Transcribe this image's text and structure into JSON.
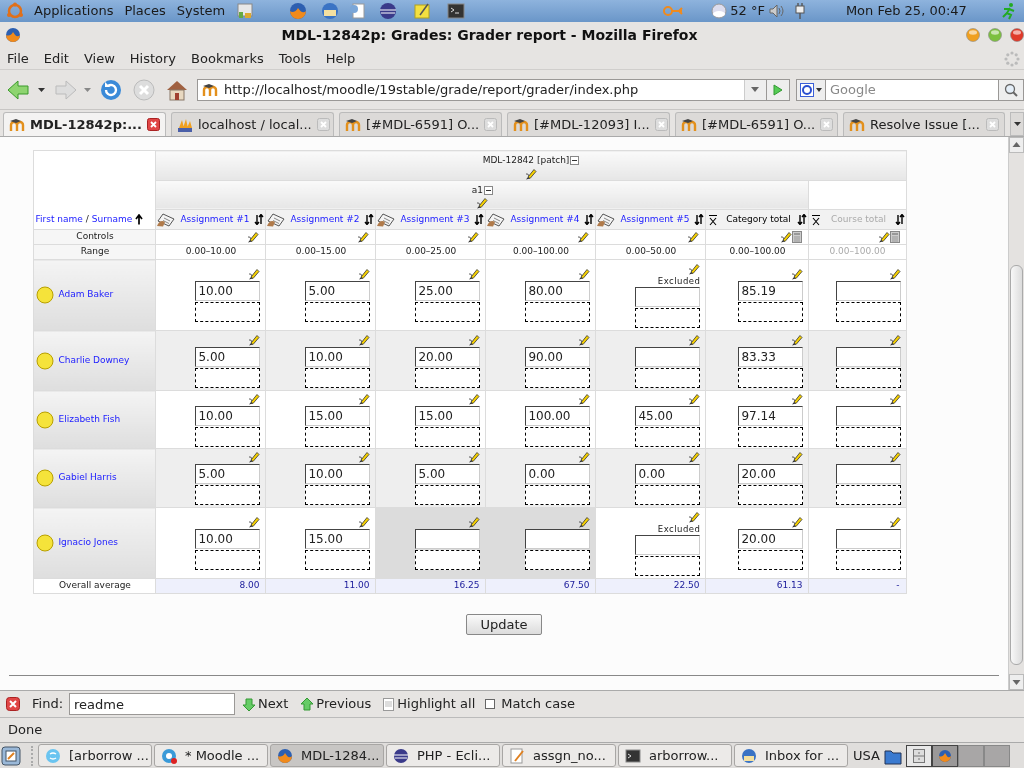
{
  "top_panel": {
    "menus": [
      "Applications",
      "Places",
      "System"
    ],
    "weather": "52 °F",
    "clock": "Mon Feb 25, 00:47"
  },
  "window": {
    "title": "MDL-12842p: Grades: Grader report - Mozilla Firefox"
  },
  "menubar": [
    "File",
    "Edit",
    "View",
    "History",
    "Bookmarks",
    "Tools",
    "Help"
  ],
  "toolbar": {
    "url": "http://localhost/moodle/19stable/grade/report/grader/index.php",
    "search_placeholder": "Google"
  },
  "tabs": [
    {
      "label": "MDL-12842p:...",
      "selected": true,
      "kind": "moodle"
    },
    {
      "label": "localhost / local...",
      "selected": false,
      "kind": "pma"
    },
    {
      "label": "[#MDL-6591] O...",
      "selected": false,
      "kind": "moodle"
    },
    {
      "label": "[#MDL-12093] I...",
      "selected": false,
      "kind": "moodle"
    },
    {
      "label": "[#MDL-6591] O...",
      "selected": false,
      "kind": "moodle"
    },
    {
      "label": "Resolve Issue [...",
      "selected": false,
      "kind": "moodle"
    }
  ],
  "grader": {
    "category": "MDL-12842 [patch]",
    "subcategory": "a1",
    "name_header": {
      "first": "First name",
      "separator": "/",
      "surname": "Surname"
    },
    "controls_label": "Controls",
    "range_label": "Range",
    "average_label": "Overall average",
    "columns": [
      {
        "label": "Assignment #1",
        "kind": "assignment",
        "range": "0.00–10.00",
        "average": "8.00"
      },
      {
        "label": "Assignment #2",
        "kind": "assignment",
        "range": "0.00–15.00",
        "average": "11.00"
      },
      {
        "label": "Assignment #3",
        "kind": "assignment",
        "range": "0.00–25.00",
        "average": "16.25"
      },
      {
        "label": "Assignment #4",
        "kind": "assignment",
        "range": "0.00–100.00",
        "average": "67.50"
      },
      {
        "label": "Assignment #5",
        "kind": "assignment",
        "range": "0.00–50.00",
        "average": "22.50"
      },
      {
        "label": "Category total",
        "kind": "category",
        "range": "0.00–100.00",
        "average": "61.13"
      },
      {
        "label": "Course total",
        "kind": "course",
        "range": "0.00–100.00",
        "average": "-"
      }
    ],
    "rows": [
      {
        "name": "Adam Baker",
        "grades": [
          {
            "value": "10.00",
            "shaded": false
          },
          {
            "value": "5.00",
            "shaded": false
          },
          {
            "value": "25.00",
            "shaded": false
          },
          {
            "value": "80.00",
            "shaded": false
          },
          {
            "note": "Excluded",
            "shaded": false
          },
          {
            "value": "85.19",
            "shaded": false
          },
          {
            "shaded": false
          }
        ]
      },
      {
        "name": "Charlie Downey",
        "grades": [
          {
            "value": "5.00",
            "shaded": false
          },
          {
            "value": "10.00",
            "shaded": false
          },
          {
            "value": "20.00",
            "shaded": false
          },
          {
            "value": "90.00",
            "shaded": false
          },
          {
            "shaded": false
          },
          {
            "value": "83.33",
            "shaded": false
          },
          {
            "shaded": false
          }
        ]
      },
      {
        "name": "Elizabeth Fish",
        "grades": [
          {
            "value": "10.00",
            "shaded": false
          },
          {
            "value": "15.00",
            "shaded": false
          },
          {
            "value": "15.00",
            "shaded": false
          },
          {
            "value": "100.00",
            "shaded": false
          },
          {
            "value": "45.00",
            "shaded": false
          },
          {
            "value": "97.14",
            "shaded": false
          },
          {
            "shaded": false
          }
        ]
      },
      {
        "name": "Gabiel Harris",
        "grades": [
          {
            "value": "5.00",
            "shaded": false
          },
          {
            "value": "10.00",
            "shaded": false
          },
          {
            "value": "5.00",
            "shaded": false
          },
          {
            "value": "0.00",
            "shaded": false
          },
          {
            "value": "0.00",
            "shaded": false
          },
          {
            "value": "20.00",
            "shaded": false
          },
          {
            "shaded": false
          }
        ]
      },
      {
        "name": "Ignacio Jones",
        "grades": [
          {
            "value": "10.00",
            "shaded": false
          },
          {
            "value": "15.00",
            "shaded": false
          },
          {
            "shaded": true
          },
          {
            "shaded": true
          },
          {
            "note": "Excluded",
            "shaded": false
          },
          {
            "value": "20.00",
            "shaded": false
          },
          {
            "shaded": false
          }
        ]
      }
    ]
  },
  "update_button": "Update",
  "find_bar": {
    "label": "Find:",
    "value": "readme",
    "next": "Next",
    "previous": "Previous",
    "highlight": "Highlight all",
    "match_case": {
      "label": "Match case",
      "checked": false
    }
  },
  "status": "Done",
  "taskbar": [
    {
      "label": "[arborrow ...",
      "selected": false,
      "kind": "chat"
    },
    {
      "label": "* Moodle ...",
      "selected": false,
      "kind": "messenger"
    },
    {
      "label": "MDL-1284...",
      "selected": true,
      "kind": "browser"
    },
    {
      "label": "PHP - Ecli...",
      "selected": false,
      "kind": "ide"
    },
    {
      "label": "assgn_no...",
      "selected": false,
      "kind": "editor"
    },
    {
      "label": "arborrow...",
      "selected": false,
      "kind": "terminal"
    },
    {
      "label": "Inbox for ...",
      "selected": false,
      "kind": "mail"
    }
  ],
  "keyboard": "USA"
}
